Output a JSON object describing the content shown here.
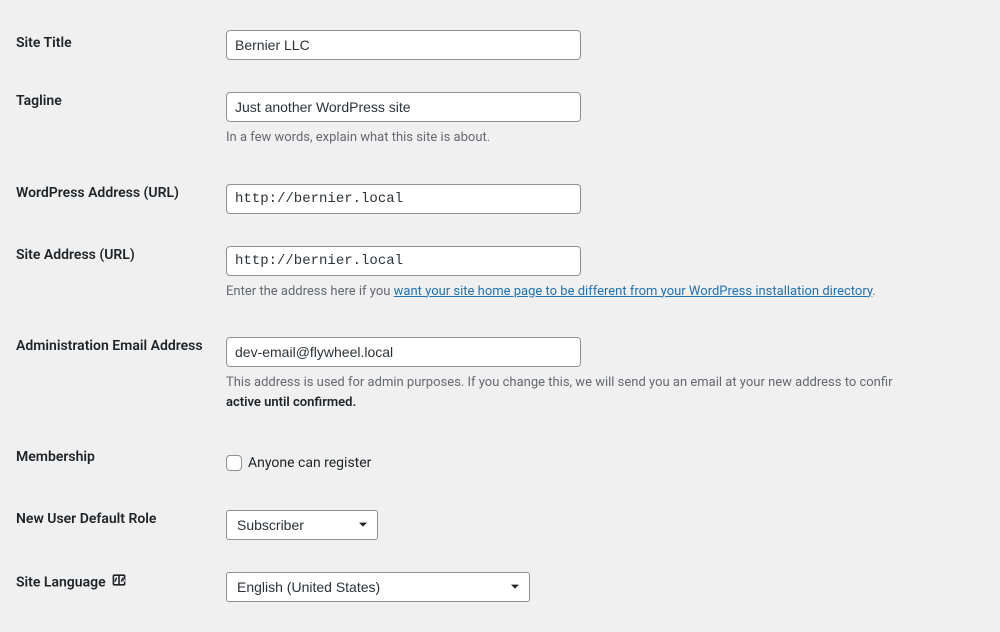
{
  "labels": {
    "site_title": "Site Title",
    "tagline": "Tagline",
    "wp_address": "WordPress Address (URL)",
    "site_address": "Site Address (URL)",
    "admin_email": "Administration Email Address",
    "membership": "Membership",
    "new_user_role": "New User Default Role",
    "site_language": "Site Language"
  },
  "values": {
    "site_title": "Bernier LLC",
    "tagline": "Just another WordPress site",
    "wp_address": "http://bernier.local",
    "site_address": "http://bernier.local",
    "admin_email": "dev-email@flywheel.local",
    "membership_checkbox_label": "Anyone can register",
    "new_user_role_selected": "Subscriber",
    "site_language_selected": "English (United States)"
  },
  "descriptions": {
    "tagline": "In a few words, explain what this site is about.",
    "site_address_prefix": "Enter the address here if you ",
    "site_address_link": "want your site home page to be different from your WordPress installation directory",
    "site_address_suffix": ".",
    "admin_email_prefix": "This address is used for admin purposes. If you change this, we will send you an email at your new address to confir",
    "admin_email_strong": "active until confirmed."
  }
}
